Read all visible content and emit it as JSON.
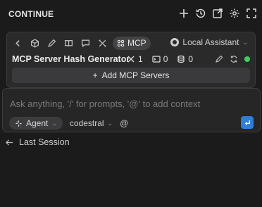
{
  "header": {
    "title": "CONTINUE",
    "icons": [
      "plus-icon",
      "history-icon",
      "open-external-icon",
      "gear-icon",
      "fullscreen-icon"
    ]
  },
  "mcp_card": {
    "toolbar_icons": [
      "chevron-left-icon",
      "cube-icon",
      "pencil-icon",
      "book-icon",
      "chat-icon",
      "tools-icon"
    ],
    "active_tab": "MCP",
    "assistant": "Local Assistant",
    "server": {
      "name": "MCP Server Hash Generator",
      "tools_count": "1",
      "prompts_count": "0",
      "resources_count": "0",
      "status_color": "#3fcf5e"
    },
    "add_button": "Add MCP Servers"
  },
  "input": {
    "placeholder": "Ask anything, '/' for prompts, '@' to add context",
    "mode": "Agent",
    "model": "codestral",
    "context_symbol": "@",
    "accent": "#2f7fd9"
  },
  "footer": {
    "last_session": "Last Session"
  }
}
